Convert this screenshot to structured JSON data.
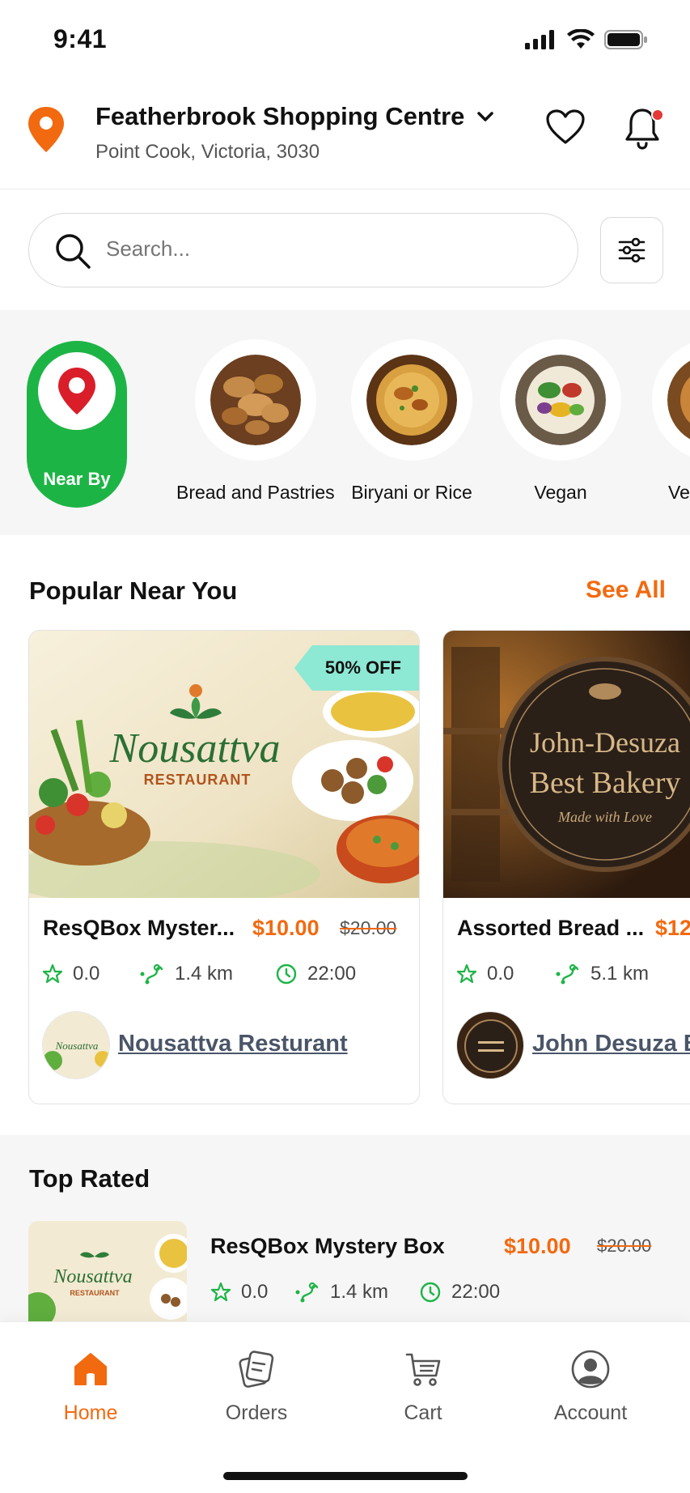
{
  "status_bar": {
    "time": "9:41"
  },
  "header": {
    "location_title": "Featherbrook Shopping Centre",
    "location_subtitle": "Point Cook, Victoria, 3030"
  },
  "search": {
    "placeholder": "Search..."
  },
  "categories": [
    {
      "label": "Near By",
      "icon": "location-pin-icon",
      "selected": true
    },
    {
      "label": "Bread and Pastries"
    },
    {
      "label": "Biryani or Rice"
    },
    {
      "label": "Vegan"
    },
    {
      "label": "Ve"
    }
  ],
  "popular": {
    "title": "Popular Near You",
    "see_all": "See All",
    "cards": [
      {
        "badge": "50% OFF",
        "image_brand": "Nousattva",
        "image_sub": "RESTAURANT",
        "name": "ResQBox Myster...",
        "price": "$10.00",
        "old_price": "$20.00",
        "rating": "0.0",
        "distance": "1.4 km",
        "time": "22:00",
        "store": "Nousattva Resturant"
      },
      {
        "image_line1": "John-Desuza",
        "image_line2": "Best Bakery",
        "image_line3": "Made with Love",
        "name": "Assorted Bread ...",
        "price": "$12",
        "rating": "0.0",
        "distance": "5.1 km",
        "store": "John Desuza Be"
      }
    ]
  },
  "top_rated": {
    "title": "Top Rated",
    "item": {
      "thumb_brand": "Nousattva",
      "thumb_sub": "RESTAURANT",
      "name": "ResQBox Mystery Box",
      "price": "$10.00",
      "old_price": "$20.00",
      "rating": "0.0",
      "distance": "1.4 km",
      "time": "22:00"
    }
  },
  "bottom_nav": [
    {
      "label": "Home",
      "icon": "home-icon",
      "active": true
    },
    {
      "label": "Orders",
      "icon": "orders-icon"
    },
    {
      "label": "Cart",
      "icon": "cart-icon"
    },
    {
      "label": "Account",
      "icon": "account-icon"
    }
  ],
  "colors": {
    "accent": "#f26a10",
    "green": "#1db446",
    "badge": "#8de8d4"
  }
}
